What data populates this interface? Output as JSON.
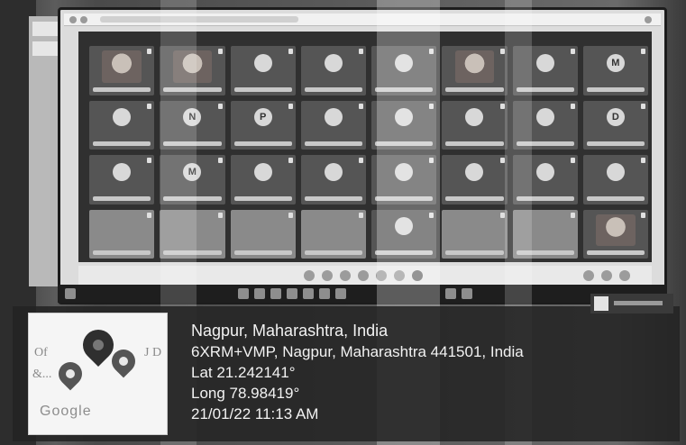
{
  "geotag": {
    "location_title": "Nagpur, Maharashtra, India",
    "address": "6XRM+VMP, Nagpur, Maharashtra 441501, India",
    "latitude": "Lat 21.242141°",
    "longitude": "Long 78.98419°",
    "datetime": "21/01/22 11:13 AM"
  },
  "map_thumbnail": {
    "label_left_top": "Of",
    "label_left_bottom": "&...",
    "label_right": "J D",
    "brand": "Google"
  },
  "meeting_grid": {
    "tiles": [
      {
        "kind": "video",
        "initial": ""
      },
      {
        "kind": "video",
        "initial": ""
      },
      {
        "kind": "avatar",
        "initial": ""
      },
      {
        "kind": "avatar",
        "initial": ""
      },
      {
        "kind": "avatar",
        "initial": ""
      },
      {
        "kind": "video",
        "initial": ""
      },
      {
        "kind": "avatar",
        "initial": ""
      },
      {
        "kind": "avatar",
        "initial": "M"
      },
      {
        "kind": "avatar",
        "initial": ""
      },
      {
        "kind": "avatar",
        "initial": "N"
      },
      {
        "kind": "avatar",
        "initial": "P"
      },
      {
        "kind": "avatar",
        "initial": ""
      },
      {
        "kind": "avatar",
        "initial": ""
      },
      {
        "kind": "avatar",
        "initial": ""
      },
      {
        "kind": "avatar",
        "initial": ""
      },
      {
        "kind": "avatar",
        "initial": "D"
      },
      {
        "kind": "avatar",
        "initial": ""
      },
      {
        "kind": "avatar",
        "initial": "M"
      },
      {
        "kind": "avatar",
        "initial": ""
      },
      {
        "kind": "avatar",
        "initial": ""
      },
      {
        "kind": "avatar",
        "initial": ""
      },
      {
        "kind": "avatar",
        "initial": ""
      },
      {
        "kind": "avatar",
        "initial": ""
      },
      {
        "kind": "avatar",
        "initial": ""
      },
      {
        "kind": "blank",
        "initial": ""
      },
      {
        "kind": "blank",
        "initial": ""
      },
      {
        "kind": "blank",
        "initial": ""
      },
      {
        "kind": "blank",
        "initial": ""
      },
      {
        "kind": "avatar",
        "initial": ""
      },
      {
        "kind": "blank",
        "initial": ""
      },
      {
        "kind": "blank",
        "initial": ""
      },
      {
        "kind": "video",
        "initial": ""
      }
    ]
  },
  "icons": {
    "map_pin": "map-pin-icon",
    "mic": "mic-icon"
  },
  "colors": {
    "overlay_text": "#f2f2f2",
    "overlay_bg": "#232323",
    "meeting_bg": "#303030"
  }
}
